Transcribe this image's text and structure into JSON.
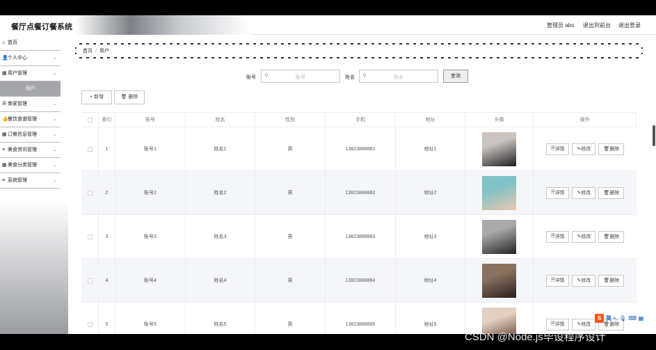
{
  "app": {
    "title": "餐厅点餐订餐系统"
  },
  "header": {
    "admin": "管理员 abo",
    "back_link": "退出到前台",
    "logout": "退出登录"
  },
  "sidebar": {
    "items": [
      {
        "label": "首页",
        "icon": "home-icon",
        "glyph": "⌂",
        "has_chevron": false
      },
      {
        "label": "个人中心",
        "icon": "user-icon",
        "glyph": "👤",
        "has_chevron": true
      },
      {
        "label": "用户管理",
        "icon": "grid-icon",
        "glyph": "▦",
        "has_chevron": true
      },
      {
        "label": "用户",
        "sub": true
      },
      {
        "label": "商家管理",
        "icon": "sliders-icon",
        "glyph": "☰",
        "has_chevron": true
      },
      {
        "label": "餐饮食谱管理",
        "icon": "thumb-icon",
        "glyph": "👍",
        "has_chevron": true
      },
      {
        "label": "订餐信息管理",
        "icon": "grid-icon",
        "glyph": "▦",
        "has_chevron": true
      },
      {
        "label": "美食资讯管理",
        "icon": "list-icon",
        "glyph": "≡",
        "has_chevron": true
      },
      {
        "label": "美食分类管理",
        "icon": "grid-icon",
        "glyph": "▦",
        "has_chevron": true
      },
      {
        "label": "系统管理",
        "icon": "list-icon",
        "glyph": "≡",
        "has_chevron": true
      }
    ]
  },
  "breadcrumb": {
    "home": "首页",
    "separator": "/",
    "current": "用户"
  },
  "search": {
    "account_label": "账号",
    "account_placeholder": "账号",
    "name_label": "姓名",
    "name_placeholder": "姓名",
    "button": "查询"
  },
  "toolbar": {
    "add": "+ 新增",
    "delete": "🗑 删除"
  },
  "table": {
    "headers": [
      "",
      "索引",
      "账号",
      "姓名",
      "性别",
      "手机",
      "地址",
      "头像",
      "操作"
    ],
    "rows": [
      {
        "index": "1",
        "account": "账号1",
        "name": "姓名1",
        "gender": "男",
        "phone": "13823888881",
        "address": "地址1",
        "avatar_colors": [
          "#c9c4bf",
          "#1e1e22"
        ]
      },
      {
        "index": "2",
        "account": "账号2",
        "name": "姓名2",
        "gender": "男",
        "phone": "13823888882",
        "address": "地址2",
        "avatar_colors": [
          "#7fc2c7",
          "#e8c7ad"
        ]
      },
      {
        "index": "3",
        "account": "账号3",
        "name": "姓名3",
        "gender": "男",
        "phone": "13823888883",
        "address": "地址3",
        "avatar_colors": [
          "#a9a9a9",
          "#222225"
        ]
      },
      {
        "index": "4",
        "account": "账号4",
        "name": "姓名4",
        "gender": "男",
        "phone": "13823888884",
        "address": "地址4",
        "avatar_colors": [
          "#8a7260",
          "#2a2020"
        ]
      },
      {
        "index": "5",
        "account": "账号5",
        "name": "姓名5",
        "gender": "男",
        "phone": "13823888885",
        "address": "地址5",
        "avatar_colors": [
          "#e3cfc3",
          "#5a3c32"
        ]
      }
    ],
    "ops": {
      "detail": "详情",
      "edit": "修改",
      "delete": "删除"
    }
  },
  "ime": {
    "logo": "S",
    "lang": "英"
  },
  "watermark": "CSDN @Node.js毕设程序设计"
}
